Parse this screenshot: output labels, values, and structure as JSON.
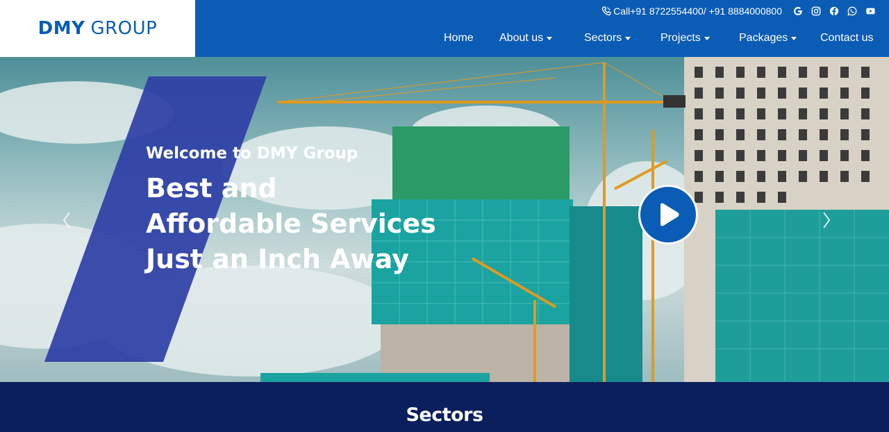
{
  "header": {
    "logo_part1": "DMY",
    "logo_part2": "GROUP",
    "phone_text": "Call+91 8722554400/ +91 8884000800",
    "social": [
      "google-icon",
      "instagram-icon",
      "facebook-icon",
      "whatsapp-icon",
      "youtube-icon"
    ]
  },
  "nav": {
    "items": [
      {
        "label": "Home",
        "dropdown": false
      },
      {
        "label": "About us",
        "dropdown": true
      },
      {
        "label": "Sectors",
        "dropdown": true
      },
      {
        "label": "Projects",
        "dropdown": true
      },
      {
        "label": "Packages",
        "dropdown": true
      },
      {
        "label": "Contact us",
        "dropdown": false
      }
    ]
  },
  "hero": {
    "subtitle": "Welcome to DMY Group",
    "title": "Best and Affordable Services Just an Inch Away"
  },
  "sectors": {
    "heading": "Sectors"
  },
  "colors": {
    "brand": "#0b5cb5",
    "navy": "#0a1f5c",
    "slant": "#2e3fa6"
  }
}
